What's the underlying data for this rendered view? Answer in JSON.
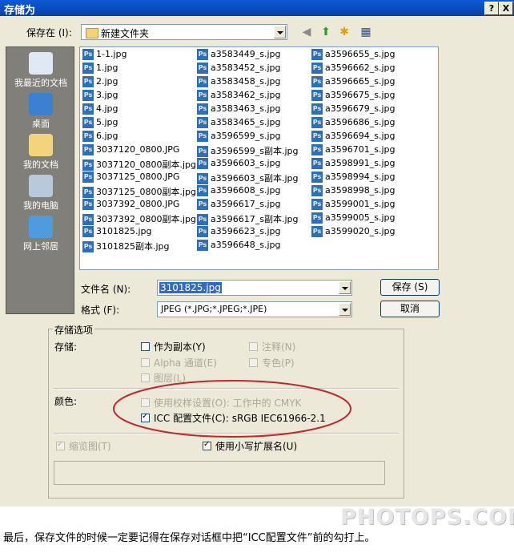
{
  "window": {
    "title": "存储为",
    "help": "?",
    "close": "X"
  },
  "save_in": {
    "label": "保存在 (I):",
    "value": "新建文件夹"
  },
  "places": [
    {
      "label": "我最近的文档"
    },
    {
      "label": "桌面"
    },
    {
      "label": "我的文档"
    },
    {
      "label": "我的电脑"
    },
    {
      "label": "网上邻居"
    }
  ],
  "files": {
    "col1": [
      "1-1.jpg",
      "1.jpg",
      "2.jpg",
      "3.jpg",
      "4.jpg",
      "5.jpg",
      "6.jpg",
      "3037120_0800.JPG",
      "3037120_0800副本.jpg",
      "3037125_0800.JPG",
      "3037125_0800副本.jpg",
      "3037392_0800.JPG",
      "3037392_0800副本.jpg",
      "3101825.jpg",
      "3101825副本.jpg"
    ],
    "col2": [
      "a3583449_s.jpg",
      "a3583452_s.jpg",
      "a3583458_s.jpg",
      "a3583462_s.jpg",
      "a3583463_s.jpg",
      "a3583465_s.jpg",
      "a3596599_s.jpg",
      "a3596599_s副本.jpg",
      "a3596603_s.jpg",
      "a3596603_s副本.jpg",
      "a3596608_s.jpg",
      "a3596617_s.jpg",
      "a3596617_s副本.jpg",
      "a3596623_s.jpg",
      "a3596648_s.jpg"
    ],
    "col3": [
      "a3596655_s.jpg",
      "a3596662_s.jpg",
      "a3596665_s.jpg",
      "a3596675_s.jpg",
      "a3596679_s.jpg",
      "a3596686_s.jpg",
      "a3596694_s.jpg",
      "a3596701_s.jpg",
      "a3598991_s.jpg",
      "a3598994_s.jpg",
      "a3598998_s.jpg",
      "a3599001_s.jpg",
      "a3599005_s.jpg",
      "a3599020_s.jpg"
    ]
  },
  "filename": {
    "label": "文件名 (N):",
    "value": "3101825.jpg"
  },
  "format": {
    "label": "格式 (F):",
    "value": "JPEG (*.JPG;*.JPEG;*.JPE)"
  },
  "buttons": {
    "save": "保存 (S)",
    "cancel": "取消"
  },
  "options": {
    "title": "存储选项",
    "store_label": "存储:",
    "as_copy": "作为副本(Y)",
    "annotations": "注释(N)",
    "alpha": "Alpha 通道(E)",
    "spot": "专色(P)",
    "layers": "图层(L)",
    "color_label": "颜色:",
    "proof": "使用校样设置(O):  工作中的 CMYK",
    "icc": "ICC 配置文件(C):  sRGB IEC61966-2.1",
    "thumbnail": "缩览图(T)",
    "lowercase": "使用小写扩展名(U)"
  },
  "caption": "最后，保存文件的时候一定要记得在保存对话框中把“ICC配置文件”前的勾打上。",
  "watermark": "PHOTOPS.COM",
  "colors": {
    "annotation_ellipse": "#c0282d",
    "title_bar": "#0a4bc4"
  }
}
